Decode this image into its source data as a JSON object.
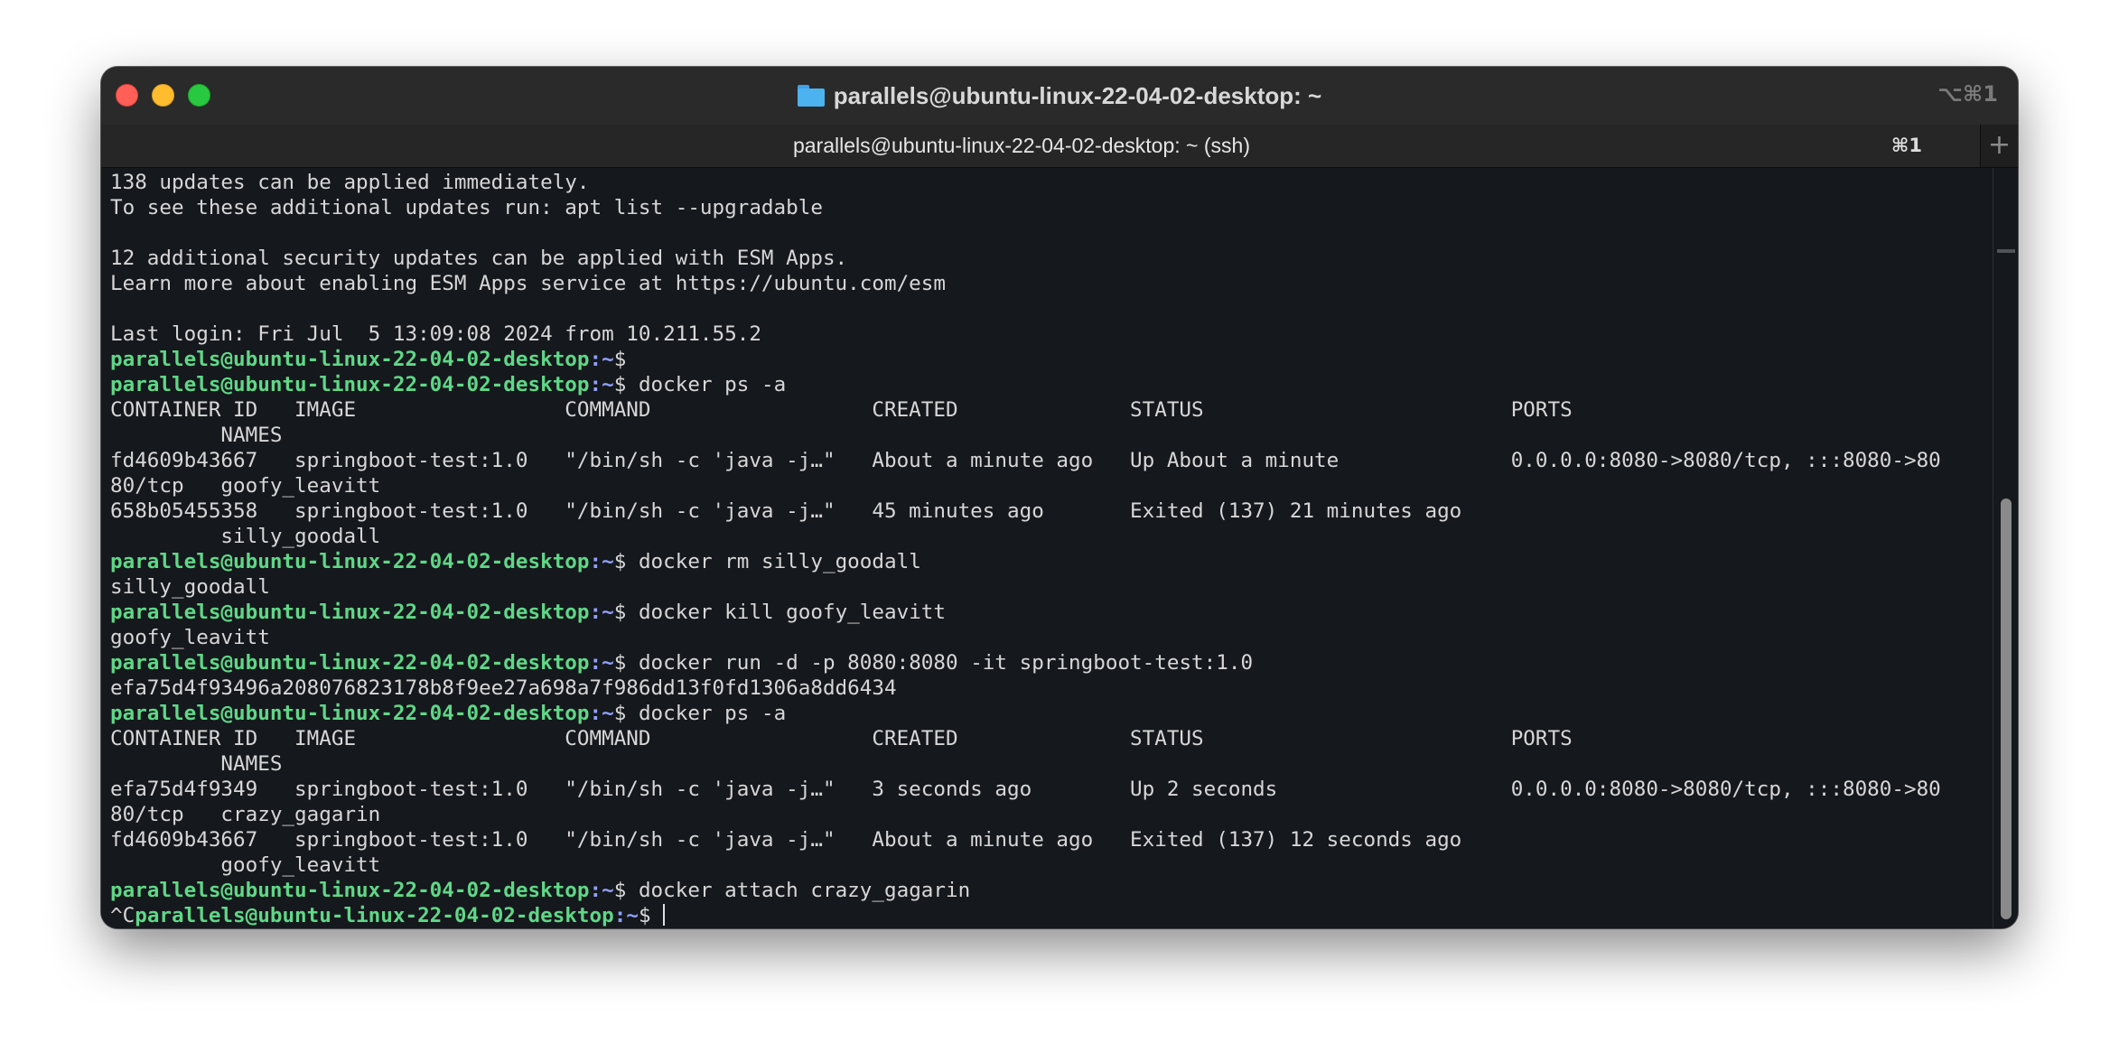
{
  "window": {
    "title": "parallels@ubuntu-linux-22-04-02-desktop: ~",
    "shortcut": "⌥⌘1",
    "folder_icon": "folder-icon"
  },
  "tab": {
    "label": "parallels@ubuntu-linux-22-04-02-desktop: ~ (ssh)",
    "shortcut": "⌘1",
    "new_tab_symbol": "+"
  },
  "colors": {
    "prompt_user": "#5fd787",
    "prompt_path": "#8fa0ff",
    "text": "#d7d7d7",
    "background": "#15181c"
  },
  "terminal": {
    "lines": [
      {
        "type": "text",
        "text": "138 updates can be applied immediately."
      },
      {
        "type": "text",
        "text": "To see these additional updates run: apt list --upgradable"
      },
      {
        "type": "text",
        "text": ""
      },
      {
        "type": "text",
        "text": "12 additional security updates can be applied with ESM Apps."
      },
      {
        "type": "text",
        "text": "Learn more about enabling ESM Apps service at https://ubuntu.com/esm"
      },
      {
        "type": "text",
        "text": ""
      },
      {
        "type": "text",
        "text": "Last login: Fri Jul  5 13:09:08 2024 from 10.211.55.2"
      },
      {
        "type": "prompt",
        "pre": "",
        "user": "parallels@ubuntu-linux-22-04-02-desktop",
        "path": ":~",
        "cmd": "$ "
      },
      {
        "type": "prompt",
        "pre": "",
        "user": "parallels@ubuntu-linux-22-04-02-desktop",
        "path": ":~",
        "cmd": "$ docker ps -a"
      },
      {
        "type": "text",
        "text": "CONTAINER ID   IMAGE                 COMMAND                  CREATED              STATUS                         PORTS"
      },
      {
        "type": "text",
        "text": "         NAMES"
      },
      {
        "type": "text",
        "text": "fd4609b43667   springboot-test:1.0   \"/bin/sh -c 'java -j…\"   About a minute ago   Up About a minute              0.0.0.0:8080->8080/tcp, :::8080->80"
      },
      {
        "type": "text",
        "text": "80/tcp   goofy_leavitt"
      },
      {
        "type": "text",
        "text": "658b05455358   springboot-test:1.0   \"/bin/sh -c 'java -j…\"   45 minutes ago       Exited (137) 21 minutes ago"
      },
      {
        "type": "text",
        "text": "         silly_goodall"
      },
      {
        "type": "prompt",
        "pre": "",
        "user": "parallels@ubuntu-linux-22-04-02-desktop",
        "path": ":~",
        "cmd": "$ docker rm silly_goodall"
      },
      {
        "type": "text",
        "text": "silly_goodall"
      },
      {
        "type": "prompt",
        "pre": "",
        "user": "parallels@ubuntu-linux-22-04-02-desktop",
        "path": ":~",
        "cmd": "$ docker kill goofy_leavitt"
      },
      {
        "type": "text",
        "text": "goofy_leavitt"
      },
      {
        "type": "prompt",
        "pre": "",
        "user": "parallels@ubuntu-linux-22-04-02-desktop",
        "path": ":~",
        "cmd": "$ docker run -d -p 8080:8080 -it springboot-test:1.0"
      },
      {
        "type": "text",
        "text": "efa75d4f93496a208076823178b8f9ee27a698a7f986dd13f0fd1306a8dd6434"
      },
      {
        "type": "prompt",
        "pre": "",
        "user": "parallels@ubuntu-linux-22-04-02-desktop",
        "path": ":~",
        "cmd": "$ docker ps -a"
      },
      {
        "type": "text",
        "text": "CONTAINER ID   IMAGE                 COMMAND                  CREATED              STATUS                         PORTS"
      },
      {
        "type": "text",
        "text": "         NAMES"
      },
      {
        "type": "text",
        "text": "efa75d4f9349   springboot-test:1.0   \"/bin/sh -c 'java -j…\"   3 seconds ago        Up 2 seconds                   0.0.0.0:8080->8080/tcp, :::8080->80"
      },
      {
        "type": "text",
        "text": "80/tcp   crazy_gagarin"
      },
      {
        "type": "text",
        "text": "fd4609b43667   springboot-test:1.0   \"/bin/sh -c 'java -j…\"   About a minute ago   Exited (137) 12 seconds ago"
      },
      {
        "type": "text",
        "text": "         goofy_leavitt"
      },
      {
        "type": "prompt",
        "pre": "",
        "user": "parallels@ubuntu-linux-22-04-02-desktop",
        "path": ":~",
        "cmd": "$ docker attach crazy_gagarin"
      },
      {
        "type": "prompt",
        "pre": "^C",
        "user": "parallels@ubuntu-linux-22-04-02-desktop",
        "path": ":~",
        "cmd": "$ ",
        "cursor": true
      }
    ]
  }
}
